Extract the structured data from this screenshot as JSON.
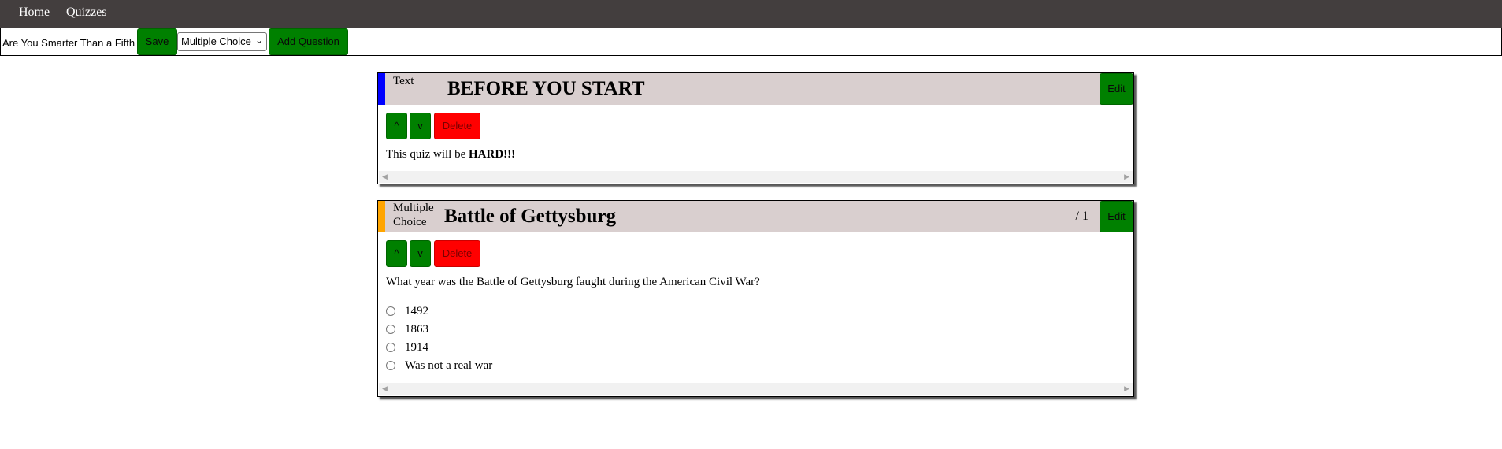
{
  "nav": {
    "home": "Home",
    "quizzes": "Quizzes"
  },
  "toolbar": {
    "quiz_title_value": "Are You Smarter Than a Fifth",
    "save_label": "Save",
    "question_type_selected": "Multiple Choice",
    "add_question_label": "Add Question"
  },
  "questions": [
    {
      "type_label": "Text",
      "title": "BEFORE YOU START",
      "stripe_color": "#0000ff",
      "edit_label": "Edit",
      "up_label": "^",
      "down_label": "v",
      "delete_label": "Delete",
      "body_prefix": "This quiz will be ",
      "body_bold": "HARD!!!"
    },
    {
      "type_label_line1": "Multiple",
      "type_label_line2": "Choice",
      "title": "Battle of Gettysburg",
      "stripe_color": "#ffa500",
      "score": "__ / 1",
      "edit_label": "Edit",
      "up_label": "^",
      "down_label": "v",
      "delete_label": "Delete",
      "prompt": "What year was the Battle of Gettysburg faught during the American Civil War?",
      "options": [
        "1492",
        "1863",
        "1914",
        "Was not a real war"
      ]
    }
  ],
  "colors": {
    "navbar_bg": "#433e3e",
    "header_bg": "#d9cfcf",
    "button_green": "#008000",
    "button_red": "#ff0000"
  },
  "icons": {
    "select_chevron": "chevron-down-icon",
    "scroll_left": "scroll-left-arrow-icon",
    "scroll_right": "scroll-right-arrow-icon"
  }
}
